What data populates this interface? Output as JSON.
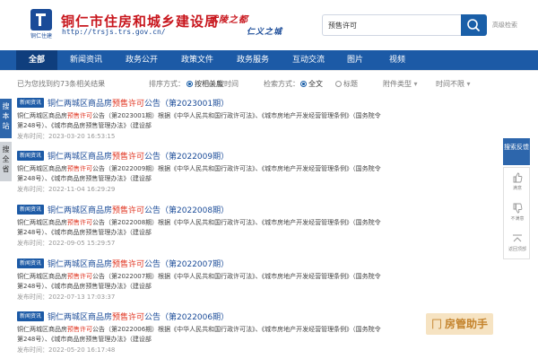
{
  "header": {
    "logo_text": "铜仁住建",
    "site_title": "铜仁市住房和城乡建设局",
    "site_url": "http://trsjs.trs.gov.cn/",
    "slogan_1": "武陵之都",
    "slogan_2": "仁义之城",
    "search_value": "预售许可",
    "advanced_search_label": "高级检索"
  },
  "nav": {
    "items": [
      "全部",
      "新闻资讯",
      "政务公开",
      "政策文件",
      "政务服务",
      "互动交流",
      "图片",
      "视频"
    ]
  },
  "filters": {
    "result_count_text": "已为您找到约73条相关结果",
    "sort_label": "排序方式：",
    "sort_options": [
      "按相关度",
      "按时间"
    ],
    "search_mode_label": "检索方式：",
    "search_mode_options": [
      "全文",
      "标题"
    ],
    "attachment_type": "附件类型",
    "time_filter": "时间不限"
  },
  "side_tabs": {
    "tab_1": "搜本站",
    "tab_2": "搜全省"
  },
  "results": [
    {
      "badge": "新闻资讯",
      "title_before": "铜仁两城区商品房",
      "title_highlight": "预售许可",
      "title_after": "公告（第2023001期）",
      "snippet_line1_before": "铜仁两城区商品房",
      "snippet_line1_highlight": "预售许可",
      "snippet_line1_after": "公告（第2023001期）根据《中华人民共和国行政许可法》、《城市房地产开发经营管理条例》（国务院令",
      "snippet_line2": "第248号）、《城市商品房预售管理办法》（建设部",
      "date": "发布时间：2023-03-20 16:53:15"
    },
    {
      "badge": "新闻资讯",
      "title_before": "铜仁两城区商品房",
      "title_highlight": "预售许可",
      "title_after": "公告（第2022009期）",
      "snippet_line1_before": "铜仁两城区商品房",
      "snippet_line1_highlight": "预售许可",
      "snippet_line1_after": "公告（第2022009期）根据《中华人民共和国行政许可法》、《城市房地产开发经营管理条例》（国务院令",
      "snippet_line2": "第248号）、《城市商品房预售管理办法》（建设部",
      "date": "发布时间：2022-11-04 16:29:29"
    },
    {
      "badge": "新闻资讯",
      "title_before": "铜仁两城区商品房",
      "title_highlight": "预售许可",
      "title_after": "公告（第2022008期）",
      "snippet_line1_before": "铜仁两城区商品房",
      "snippet_line1_highlight": "预售许可",
      "snippet_line1_after": "公告（第2022008期）根据《中华人民共和国行政许可法》、《城市房地产开发经营管理条例》（国务院令",
      "snippet_line2": "第248号）、《城市商品房预售管理办法》（建设部",
      "date": "发布时间：2022-09-05 15:29:57"
    },
    {
      "badge": "新闻资讯",
      "title_before": "铜仁两城区商品房",
      "title_highlight": "预售许可",
      "title_after": "公告（第2022007期）",
      "snippet_line1_before": "铜仁两城区商品房",
      "snippet_line1_highlight": "预售许可",
      "snippet_line1_after": "公告（第2022007期）根据《中华人民共和国行政许可法》、《城市房地产开发经营管理条例》（国务院令",
      "snippet_line2": "第248号）、《城市商品房预售管理办法》（建设部",
      "date": "发布时间：2022-07-13 17:03:37"
    },
    {
      "badge": "新闻资讯",
      "title_before": "铜仁两城区商品房",
      "title_highlight": "预售许可",
      "title_after": "公告（第2022006期）",
      "snippet_line1_before": "铜仁两城区商品房",
      "snippet_line1_highlight": "预售许可",
      "snippet_line1_after": "公告（第2022006期）根据《中华人民共和国行政许可法》、《城市房地产开发经营管理条例》（国务院令",
      "snippet_line2": "第248号）、《城市商品房预售管理办法》（建设部",
      "date": "发布时间：2022-05-20 16:17:48"
    }
  ],
  "right_toolbar": {
    "search_feedback": "搜索反馈",
    "satisfied": "满意",
    "unsatisfied": "不满意",
    "back_to_top": "返回顶部"
  },
  "watermark": {
    "text": "房管助手"
  },
  "colors": {
    "brand_blue": "#1c5aa6",
    "title_red": "#c8161d",
    "highlight_red": "#e0321e"
  }
}
